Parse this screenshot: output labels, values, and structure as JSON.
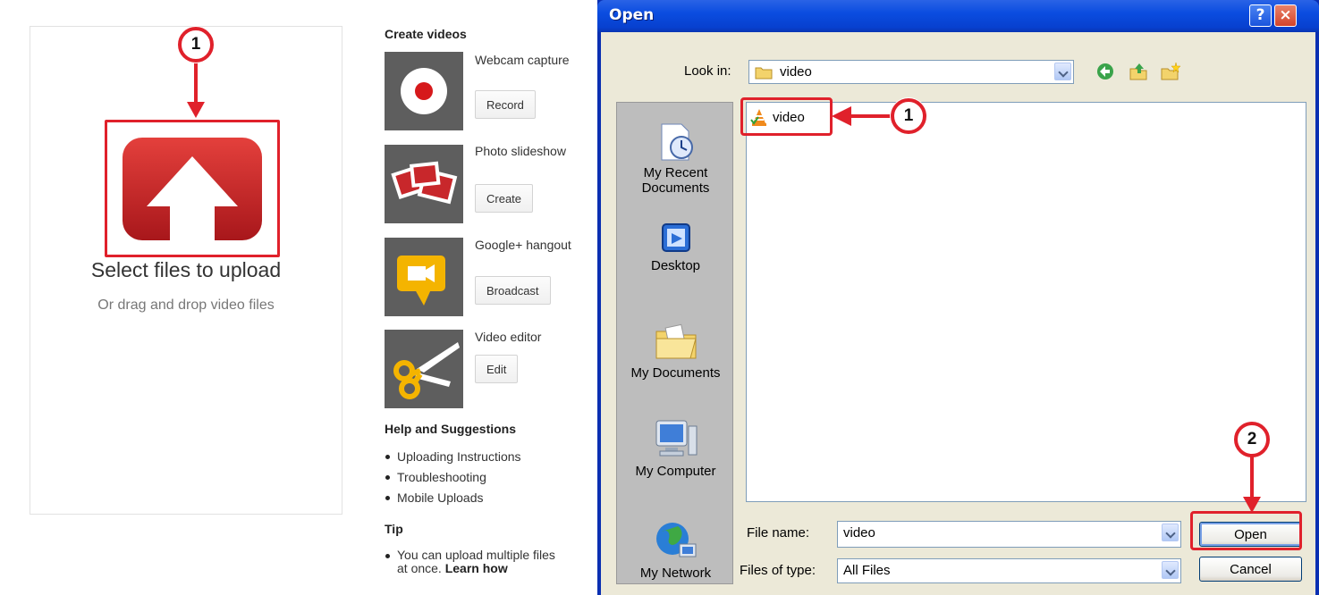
{
  "upload": {
    "title": "Select files to upload",
    "subtitle": "Or drag and drop video files"
  },
  "create_videos": {
    "heading": "Create videos",
    "options": [
      {
        "label": "Webcam capture",
        "button": "Record",
        "icon": "record-icon"
      },
      {
        "label": "Photo slideshow",
        "button": "Create",
        "icon": "photos-icon"
      },
      {
        "label": "Google+ hangout",
        "button": "Broadcast",
        "icon": "hangout-camera-icon"
      },
      {
        "label": "Video editor",
        "button": "Edit",
        "icon": "scissors-icon"
      }
    ]
  },
  "help": {
    "heading": "Help and Suggestions",
    "links": [
      "Uploading Instructions",
      "Troubleshooting",
      "Mobile Uploads"
    ]
  },
  "tip": {
    "heading": "Tip",
    "text": "You can upload multiple files at once.",
    "link": "Learn how"
  },
  "dialog": {
    "title": "Open",
    "help_button": "?",
    "close_button": "×",
    "look_in_label": "Look in:",
    "look_in_value": "video",
    "places": [
      {
        "label": "My Recent Documents",
        "icon": "recent-documents-icon"
      },
      {
        "label": "Desktop",
        "icon": "desktop-icon"
      },
      {
        "label": "My Documents",
        "icon": "my-documents-icon"
      },
      {
        "label": "My Computer",
        "icon": "my-computer-icon"
      },
      {
        "label": "My Network",
        "icon": "my-network-icon"
      }
    ],
    "files": [
      {
        "name": "video",
        "icon": "vlc-file-icon"
      }
    ],
    "file_name_label": "File name:",
    "file_name_value": "video",
    "file_type_label": "Files of type:",
    "file_type_value": "All Files",
    "open_button": "Open",
    "cancel_button": "Cancel"
  },
  "annotations": {
    "step1": "1",
    "step2": "2",
    "color": "#e0212b"
  },
  "colors": {
    "brand_red": "#d62a2a",
    "xp_blue": "#0b4de0"
  }
}
